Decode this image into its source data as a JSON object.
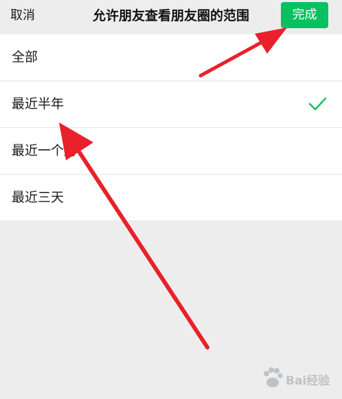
{
  "navbar": {
    "cancel_label": "取消",
    "title": "允许朋友查看朋友圈的范围",
    "done_label": "完成"
  },
  "options": [
    {
      "label": "全部",
      "selected": false
    },
    {
      "label": "最近半年",
      "selected": true
    },
    {
      "label": "最近一个月",
      "selected": false
    },
    {
      "label": "最近三天",
      "selected": false
    }
  ],
  "check_icon": "checkmark-icon",
  "watermark": {
    "text": "Bai经验",
    "logo": "paw-icon"
  },
  "colors": {
    "accent": "#07c160",
    "annotation_arrow": "#e8212b",
    "background": "#ededed",
    "list_background": "#ffffff"
  }
}
